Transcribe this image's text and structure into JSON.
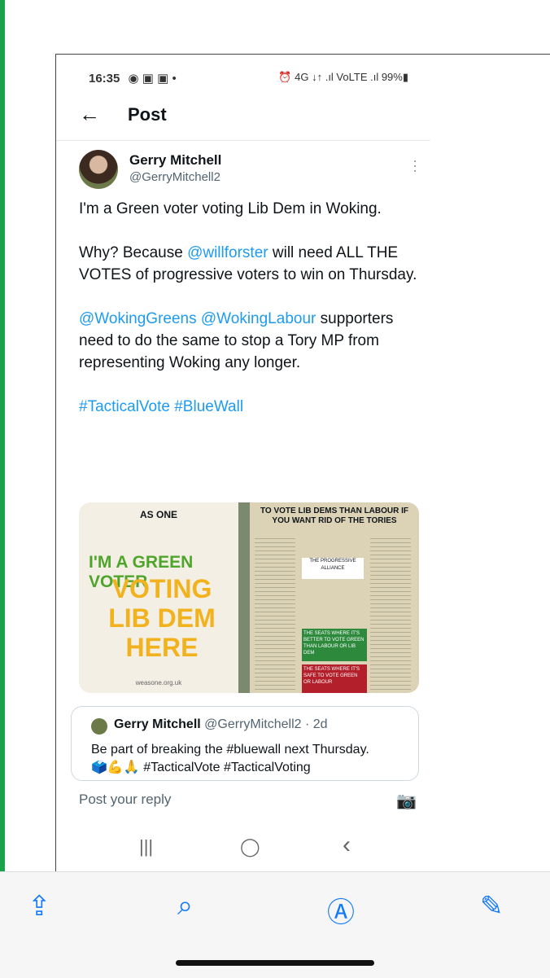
{
  "status": {
    "time": "16:35",
    "right": "⏰ 4G ↓↑ .ıl VoLTE .ıl 99%▮"
  },
  "header": {
    "title": "Post"
  },
  "tweet": {
    "name": "Gerry Mitchell",
    "handle": "@GerryMitchell2",
    "line1": "I'm a Green voter voting Lib Dem in Woking.",
    "line2a": "Why? Because ",
    "mention1": "@willforster",
    "line2b": " will need ALL THE VOTES of progressive voters to win on Thursday.",
    "mention2": "@WokingGreens @WokingLabour",
    "line3": " supporters need to do the same to stop a Tory MP from representing Woking any longer.",
    "hashtags": "#TacticalVote #BlueWall"
  },
  "media": {
    "poster_top": "AS ONE",
    "poster_l1": "I'M A GREEN VOTER",
    "poster_l2": "VOTING LIB DEM HERE",
    "poster_url": "weasone.org.uk",
    "flyer_head": "TO VOTE LIB DEMS THAN LABOUR IF YOU WANT RID OF THE TORIES",
    "flyer_box1": "THE PROGRESSIVE ALLIANCE",
    "flyer_box2": "THE SEATS WHERE IT'S BETTER TO VOTE GREEN THAN LABOUR OR LIB DEM",
    "flyer_box3": "THE SEATS WHERE IT'S SAFE TO VOTE GREEN OR LABOUR"
  },
  "quote": {
    "name": "Gerry Mitchell",
    "handle": "@GerryMitchell2 · 2d",
    "text1": "Be part of breaking the #bluewall next Thursday.",
    "text2": "🗳️💪🙏 #TacticalVote #TacticalVoting"
  },
  "reply": {
    "placeholder": "Post your reply"
  },
  "nav": {
    "recents": "|||",
    "home": "◯",
    "back": "‹"
  }
}
